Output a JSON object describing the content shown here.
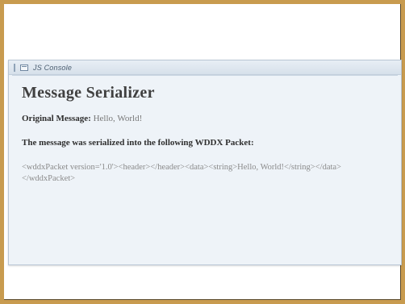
{
  "console": {
    "title": "JS Console",
    "heading": "Message Serializer",
    "original_label": "Original Message:",
    "original_value": "Hello, World!",
    "serialized_note": "The message was serialized into the following WDDX Packet:",
    "packet": "<wddxPacket version='1.0'><header></header><data><string>Hello, World!</string></data></wddxPacket>"
  }
}
